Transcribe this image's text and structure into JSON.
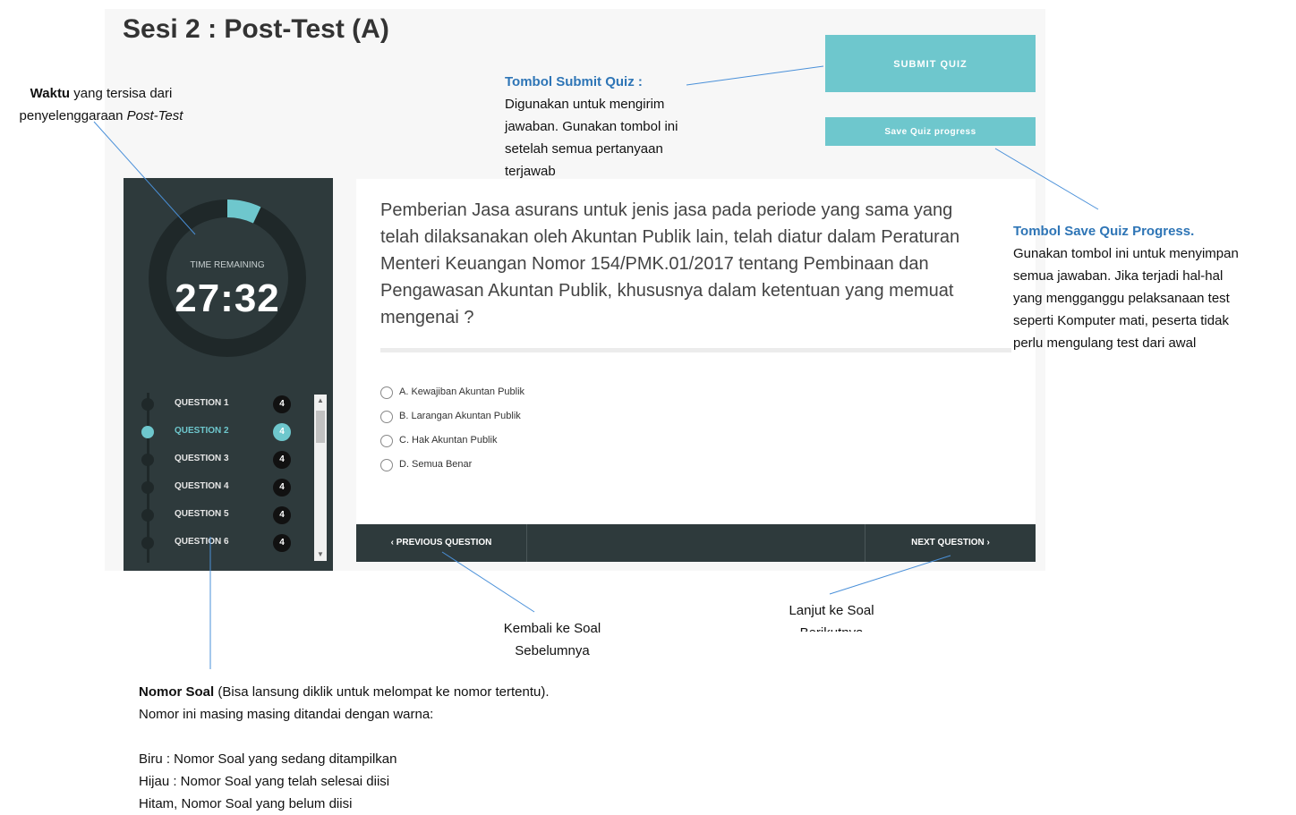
{
  "page": {
    "title": "Sesi 2 : Post-Test (A)"
  },
  "buttons": {
    "submit": "SUBMIT QUIZ",
    "save": "Save Quiz progress"
  },
  "timer": {
    "label": "TIME REMAINING",
    "value": "27:32",
    "progress_fraction": 0.07
  },
  "questions": [
    {
      "label": "QUESTION 1",
      "badge": "4",
      "state": "normal"
    },
    {
      "label": "QUESTION 2",
      "badge": "4",
      "state": "active"
    },
    {
      "label": "QUESTION 3",
      "badge": "4",
      "state": "normal"
    },
    {
      "label": "QUESTION 4",
      "badge": "4",
      "state": "normal"
    },
    {
      "label": "QUESTION 5",
      "badge": "4",
      "state": "normal"
    },
    {
      "label": "QUESTION 6",
      "badge": "4",
      "state": "normal"
    }
  ],
  "question": {
    "text": "Pemberian Jasa asurans untuk jenis jasa pada periode yang sama yang telah dilaksanakan oleh Akuntan Publik lain, telah diatur dalam Peraturan Menteri Keuangan Nomor 154/PMK.01/2017 tentang Pembinaan dan Pengawasan Akuntan Publik, khususnya dalam ketentuan yang memuat mengenai ?",
    "options": [
      "A. Kewajiban Akuntan Publik",
      "B. Larangan Akuntan Publik",
      "C. Hak Akuntan Publik",
      "D. Semua Benar"
    ]
  },
  "nav": {
    "prev": "‹ PREVIOUS QUESTION",
    "next": "NEXT QUESTION ›"
  },
  "annotations": {
    "waktu": {
      "bold": "Waktu",
      "text1": " yang tersisa dari",
      "text2": "penyelenggaraan ",
      "italic": "Post-Test"
    },
    "submit": {
      "title": "Tombol Submit Quiz :",
      "lines": [
        "Digunakan untuk mengirim",
        "jawaban. Gunakan tombol ini",
        "setelah semua pertanyaan",
        "terjawab"
      ]
    },
    "save": {
      "title": "Tombol Save Quiz Progress.",
      "lines": [
        "Gunakan tombol ini untuk menyimpan",
        "semua jawaban. Jika terjadi hal-hal",
        "yang mengganggu pelaksanaan test",
        "seperti Komputer mati, peserta tidak",
        "perlu mengulang test dari awal"
      ]
    },
    "prev": {
      "lines": [
        "Kembali ke Soal",
        "Sebelumnya"
      ]
    },
    "next": {
      "lines": [
        "Lanjut ke Soal",
        "Berikutnya"
      ]
    },
    "nomor": {
      "bold": "Nomor Soal",
      "text1": " (Bisa lansung diklik untuk melompat ke nomor tertentu).",
      "line2": "Nomor ini masing masing ditandai dengan warna:",
      "legend": [
        "Biru : Nomor Soal yang sedang ditampilkan",
        "Hijau : Nomor Soal yang telah selesai diisi",
        "Hitam, Nomor Soal yang belum diisi"
      ]
    }
  },
  "colors": {
    "accent": "#6ec7cd",
    "sidebar": "#2e3a3c",
    "annotation_title": "#2e75b6"
  }
}
